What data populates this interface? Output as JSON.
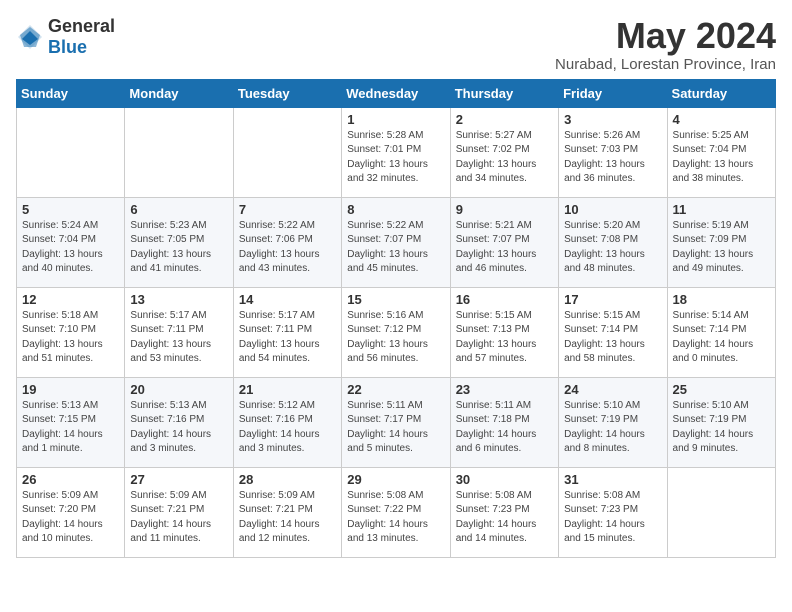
{
  "logo": {
    "text_general": "General",
    "text_blue": "Blue"
  },
  "header": {
    "month_year": "May 2024",
    "location": "Nurabad, Lorestan Province, Iran"
  },
  "weekdays": [
    "Sunday",
    "Monday",
    "Tuesday",
    "Wednesday",
    "Thursday",
    "Friday",
    "Saturday"
  ],
  "weeks": [
    [
      {
        "day": "",
        "sunrise": "",
        "sunset": "",
        "daylight": ""
      },
      {
        "day": "",
        "sunrise": "",
        "sunset": "",
        "daylight": ""
      },
      {
        "day": "",
        "sunrise": "",
        "sunset": "",
        "daylight": ""
      },
      {
        "day": "1",
        "sunrise": "Sunrise: 5:28 AM",
        "sunset": "Sunset: 7:01 PM",
        "daylight": "Daylight: 13 hours and 32 minutes."
      },
      {
        "day": "2",
        "sunrise": "Sunrise: 5:27 AM",
        "sunset": "Sunset: 7:02 PM",
        "daylight": "Daylight: 13 hours and 34 minutes."
      },
      {
        "day": "3",
        "sunrise": "Sunrise: 5:26 AM",
        "sunset": "Sunset: 7:03 PM",
        "daylight": "Daylight: 13 hours and 36 minutes."
      },
      {
        "day": "4",
        "sunrise": "Sunrise: 5:25 AM",
        "sunset": "Sunset: 7:04 PM",
        "daylight": "Daylight: 13 hours and 38 minutes."
      }
    ],
    [
      {
        "day": "5",
        "sunrise": "Sunrise: 5:24 AM",
        "sunset": "Sunset: 7:04 PM",
        "daylight": "Daylight: 13 hours and 40 minutes."
      },
      {
        "day": "6",
        "sunrise": "Sunrise: 5:23 AM",
        "sunset": "Sunset: 7:05 PM",
        "daylight": "Daylight: 13 hours and 41 minutes."
      },
      {
        "day": "7",
        "sunrise": "Sunrise: 5:22 AM",
        "sunset": "Sunset: 7:06 PM",
        "daylight": "Daylight: 13 hours and 43 minutes."
      },
      {
        "day": "8",
        "sunrise": "Sunrise: 5:22 AM",
        "sunset": "Sunset: 7:07 PM",
        "daylight": "Daylight: 13 hours and 45 minutes."
      },
      {
        "day": "9",
        "sunrise": "Sunrise: 5:21 AM",
        "sunset": "Sunset: 7:07 PM",
        "daylight": "Daylight: 13 hours and 46 minutes."
      },
      {
        "day": "10",
        "sunrise": "Sunrise: 5:20 AM",
        "sunset": "Sunset: 7:08 PM",
        "daylight": "Daylight: 13 hours and 48 minutes."
      },
      {
        "day": "11",
        "sunrise": "Sunrise: 5:19 AM",
        "sunset": "Sunset: 7:09 PM",
        "daylight": "Daylight: 13 hours and 49 minutes."
      }
    ],
    [
      {
        "day": "12",
        "sunrise": "Sunrise: 5:18 AM",
        "sunset": "Sunset: 7:10 PM",
        "daylight": "Daylight: 13 hours and 51 minutes."
      },
      {
        "day": "13",
        "sunrise": "Sunrise: 5:17 AM",
        "sunset": "Sunset: 7:11 PM",
        "daylight": "Daylight: 13 hours and 53 minutes."
      },
      {
        "day": "14",
        "sunrise": "Sunrise: 5:17 AM",
        "sunset": "Sunset: 7:11 PM",
        "daylight": "Daylight: 13 hours and 54 minutes."
      },
      {
        "day": "15",
        "sunrise": "Sunrise: 5:16 AM",
        "sunset": "Sunset: 7:12 PM",
        "daylight": "Daylight: 13 hours and 56 minutes."
      },
      {
        "day": "16",
        "sunrise": "Sunrise: 5:15 AM",
        "sunset": "Sunset: 7:13 PM",
        "daylight": "Daylight: 13 hours and 57 minutes."
      },
      {
        "day": "17",
        "sunrise": "Sunrise: 5:15 AM",
        "sunset": "Sunset: 7:14 PM",
        "daylight": "Daylight: 13 hours and 58 minutes."
      },
      {
        "day": "18",
        "sunrise": "Sunrise: 5:14 AM",
        "sunset": "Sunset: 7:14 PM",
        "daylight": "Daylight: 14 hours and 0 minutes."
      }
    ],
    [
      {
        "day": "19",
        "sunrise": "Sunrise: 5:13 AM",
        "sunset": "Sunset: 7:15 PM",
        "daylight": "Daylight: 14 hours and 1 minute."
      },
      {
        "day": "20",
        "sunrise": "Sunrise: 5:13 AM",
        "sunset": "Sunset: 7:16 PM",
        "daylight": "Daylight: 14 hours and 3 minutes."
      },
      {
        "day": "21",
        "sunrise": "Sunrise: 5:12 AM",
        "sunset": "Sunset: 7:16 PM",
        "daylight": "Daylight: 14 hours and 3 minutes."
      },
      {
        "day": "22",
        "sunrise": "Sunrise: 5:11 AM",
        "sunset": "Sunset: 7:17 PM",
        "daylight": "Daylight: 14 hours and 5 minutes."
      },
      {
        "day": "23",
        "sunrise": "Sunrise: 5:11 AM",
        "sunset": "Sunset: 7:18 PM",
        "daylight": "Daylight: 14 hours and 6 minutes."
      },
      {
        "day": "24",
        "sunrise": "Sunrise: 5:10 AM",
        "sunset": "Sunset: 7:19 PM",
        "daylight": "Daylight: 14 hours and 8 minutes."
      },
      {
        "day": "25",
        "sunrise": "Sunrise: 5:10 AM",
        "sunset": "Sunset: 7:19 PM",
        "daylight": "Daylight: 14 hours and 9 minutes."
      }
    ],
    [
      {
        "day": "26",
        "sunrise": "Sunrise: 5:09 AM",
        "sunset": "Sunset: 7:20 PM",
        "daylight": "Daylight: 14 hours and 10 minutes."
      },
      {
        "day": "27",
        "sunrise": "Sunrise: 5:09 AM",
        "sunset": "Sunset: 7:21 PM",
        "daylight": "Daylight: 14 hours and 11 minutes."
      },
      {
        "day": "28",
        "sunrise": "Sunrise: 5:09 AM",
        "sunset": "Sunset: 7:21 PM",
        "daylight": "Daylight: 14 hours and 12 minutes."
      },
      {
        "day": "29",
        "sunrise": "Sunrise: 5:08 AM",
        "sunset": "Sunset: 7:22 PM",
        "daylight": "Daylight: 14 hours and 13 minutes."
      },
      {
        "day": "30",
        "sunrise": "Sunrise: 5:08 AM",
        "sunset": "Sunset: 7:23 PM",
        "daylight": "Daylight: 14 hours and 14 minutes."
      },
      {
        "day": "31",
        "sunrise": "Sunrise: 5:08 AM",
        "sunset": "Sunset: 7:23 PM",
        "daylight": "Daylight: 14 hours and 15 minutes."
      },
      {
        "day": "",
        "sunrise": "",
        "sunset": "",
        "daylight": ""
      }
    ]
  ]
}
